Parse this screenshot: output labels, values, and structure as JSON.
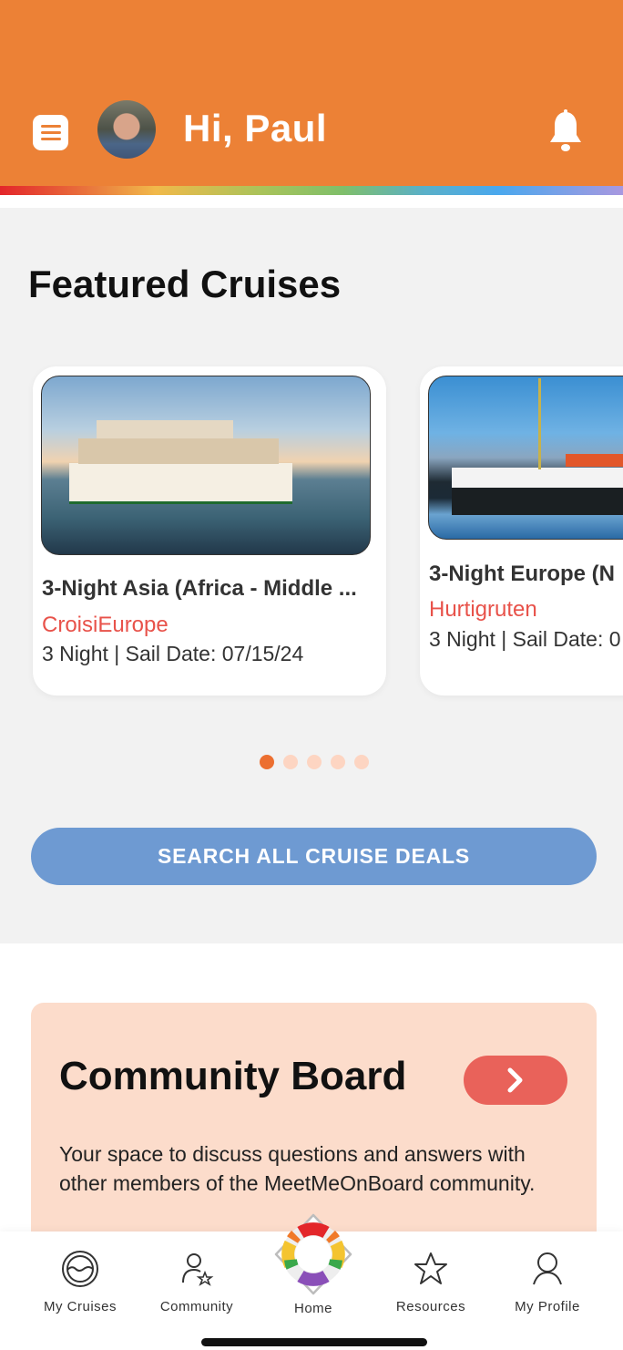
{
  "header": {
    "greeting": "Hi, Paul",
    "menu_icon": "hamburger-menu-icon",
    "notification_icon": "bell-icon",
    "brand_color": "#ec8136"
  },
  "featured": {
    "title": "Featured Cruises",
    "cards": [
      {
        "title": "3-Night Asia (Africa - Middle ...",
        "cruise_line": "CroisiEurope",
        "meta": "3 Night | Sail Date: 07/15/24"
      },
      {
        "title": "3-Night Europe (N",
        "cruise_line": "Hurtigruten",
        "meta": "3 Night | Sail Date: 0"
      }
    ],
    "pagination": {
      "total": 5,
      "active": 1
    },
    "search_button": "SEARCH ALL CRUISE DEALS"
  },
  "community": {
    "title": "Community Board",
    "description": "Your space to discuss questions and answers with other members of the MeetMeOnBoard community.",
    "go_icon": "chevron-right-icon"
  },
  "tabbar": {
    "items": [
      {
        "label": "My Cruises",
        "icon": "porthole-icon"
      },
      {
        "label": "Community",
        "icon": "person-star-icon"
      },
      {
        "label": "Home",
        "icon": "rainbow-lifebuoy-icon"
      },
      {
        "label": "Resources",
        "icon": "star-icon"
      },
      {
        "label": "My Profile",
        "icon": "person-icon"
      }
    ]
  },
  "colors": {
    "accent_orange": "#ec8136",
    "cruise_line_red": "#e8524a",
    "search_blue": "#6e9ad2",
    "community_bg": "#fcdccb",
    "community_button": "#e9625a"
  }
}
